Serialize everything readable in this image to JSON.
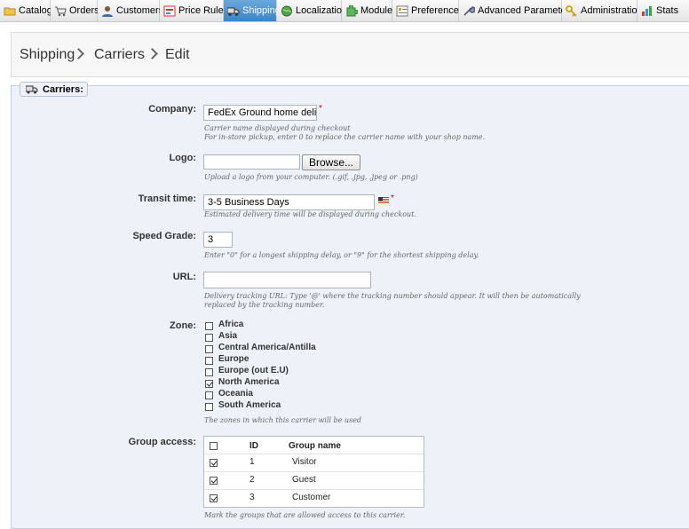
{
  "tabs": [
    {
      "label": "Catalog",
      "icon": "folder-icon"
    },
    {
      "label": "Orders",
      "icon": "cart-icon"
    },
    {
      "label": "Customers",
      "icon": "user-icon"
    },
    {
      "label": "Price Rules",
      "icon": "price-tag-icon"
    },
    {
      "label": "Shipping",
      "icon": "truck-icon",
      "active": true
    },
    {
      "label": "Localization",
      "icon": "globe-icon"
    },
    {
      "label": "Modules",
      "icon": "puzzle-icon"
    },
    {
      "label": "Preferences",
      "icon": "preferences-icon"
    },
    {
      "label": "Advanced Parameters",
      "icon": "wrench-icon"
    },
    {
      "label": "Administration",
      "icon": "key-icon"
    },
    {
      "label": "Stats",
      "icon": "chart-icon"
    }
  ],
  "breadcrumb": [
    "Shipping",
    "Carriers",
    "Edit"
  ],
  "legend": "Carriers:",
  "fields": {
    "company": {
      "label": "Company:",
      "value": "FedEx Ground home delivery",
      "help1": "Carrier name displayed during checkout",
      "help2": "For in-store pickup, enter 0 to replace the carrier name with your shop name."
    },
    "logo": {
      "label": "Logo:",
      "value": "",
      "button": "Browse...",
      "help": "Upload a logo from your computer. (.gif, .jpg, .jpeg or .png)"
    },
    "transit": {
      "label": "Transit time:",
      "value": "3-5 Business Days",
      "help": "Estimated delivery time will be displayed during checkout."
    },
    "speed": {
      "label": "Speed Grade:",
      "value": "3",
      "help": "Enter \"0\" for a longest shipping delay, or \"9\" for the shortest shipping delay."
    },
    "url": {
      "label": "URL:",
      "value": "",
      "help1": "Delivery tracking URL: Type '@' where the tracking number should appear. It will then be automatically",
      "help2": "replaced by the tracking number."
    },
    "zone": {
      "label": "Zone:",
      "help": "The zones in which this carrier will be used",
      "items": [
        {
          "name": "Africa",
          "checked": false
        },
        {
          "name": "Asia",
          "checked": false
        },
        {
          "name": "Central America/Antilla",
          "checked": false
        },
        {
          "name": "Europe",
          "checked": false
        },
        {
          "name": "Europe (out E.U)",
          "checked": false
        },
        {
          "name": "North America",
          "checked": true
        },
        {
          "name": "Oceania",
          "checked": false
        },
        {
          "name": "South America",
          "checked": false
        }
      ]
    },
    "group": {
      "label": "Group access:",
      "help": "Mark the groups that are allowed access to this carrier.",
      "headers": {
        "id": "ID",
        "name": "Group name"
      },
      "rows": [
        {
          "id": "1",
          "name": "Visitor",
          "checked": true
        },
        {
          "id": "2",
          "name": "Guest",
          "checked": true
        },
        {
          "id": "3",
          "name": "Customer",
          "checked": true
        }
      ]
    }
  },
  "required_mark": "*",
  "colors": {
    "active_tab": "#3d84c6",
    "panel_bg": "#eef1f8"
  }
}
